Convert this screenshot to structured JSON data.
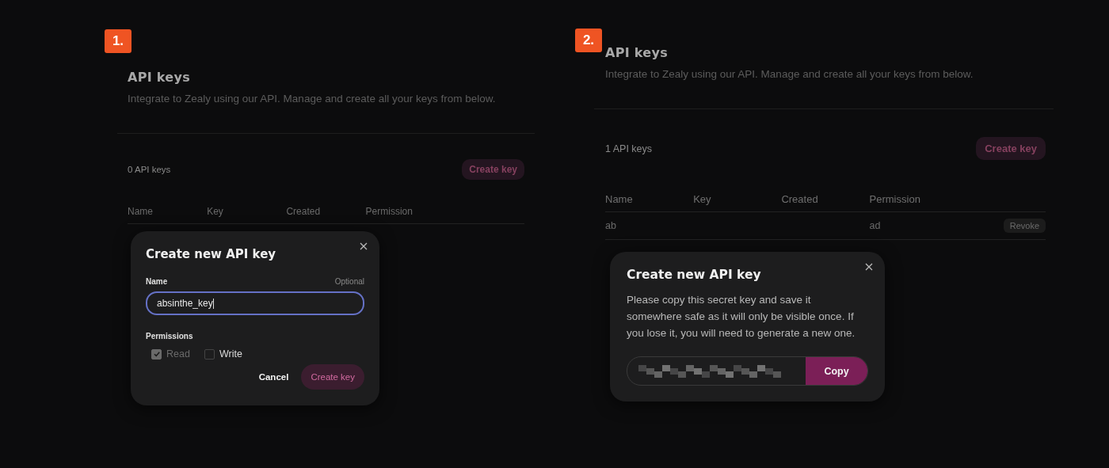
{
  "panels": [
    {
      "step": "1.",
      "title": "API keys",
      "subtitle": "Integrate to Zealy using our API. Manage and create all your keys from below.",
      "count": "0 API keys",
      "create_button": "Create key",
      "columns": [
        "Name",
        "Key",
        "Created",
        "Permission"
      ],
      "modal": {
        "kind": "form",
        "title": "Create new API key",
        "name_label": "Name",
        "optional": "Optional",
        "value": "absinthe_key",
        "focused": true,
        "permissions_label": "Permissions",
        "permissions": [
          {
            "label": "Read",
            "checked": true,
            "disabled": true
          },
          {
            "label": "Write",
            "checked": false,
            "disabled": false
          }
        ],
        "cancel": "Cancel",
        "submit": "Create key"
      }
    },
    {
      "step": "2.",
      "title": "API keys",
      "subtitle": "Integrate to Zealy using our API. Manage and create all your keys from below.",
      "count": "1 API keys",
      "create_button": "Create key",
      "columns": [
        "Name",
        "Key",
        "Created",
        "Permission"
      ],
      "rows": [
        {
          "name": "ab",
          "permission": "ad",
          "action": "Revoke"
        }
      ],
      "modal": {
        "kind": "secret",
        "title": "Create new API key",
        "message": "Please copy this secret key and save it somewhere safe as it will only be visible once. If you lose it, you will need to generate a new one.",
        "copy": "Copy"
      }
    }
  ]
}
